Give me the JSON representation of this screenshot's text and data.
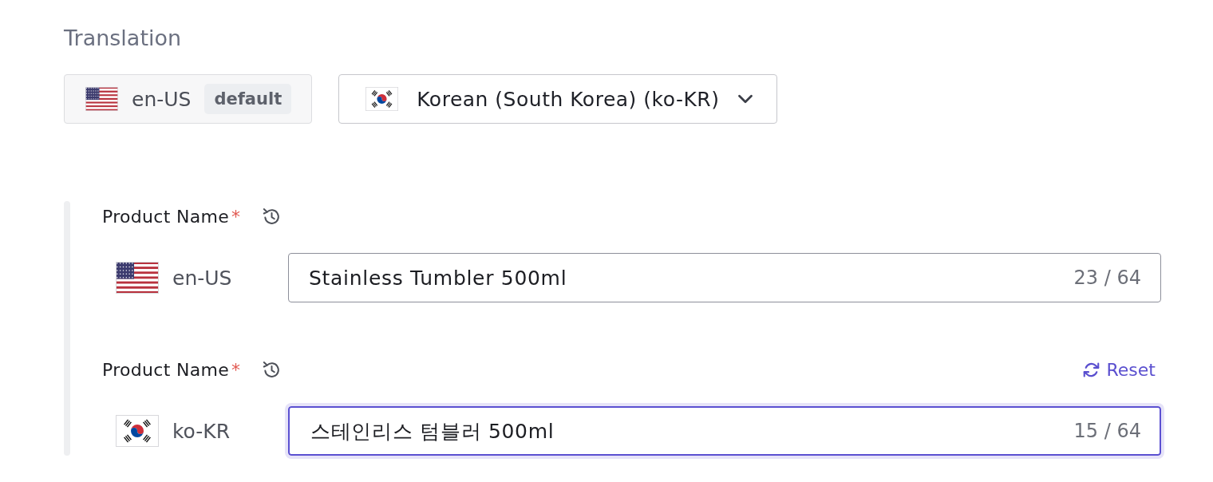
{
  "title": "Translation",
  "locale_bar": {
    "default_locale": {
      "code": "en-US",
      "badge": "default"
    },
    "target_locale": {
      "label": "Korean (South Korea) (ko-KR)"
    }
  },
  "fields": [
    {
      "kind": "source",
      "label": "Product Name",
      "required_mark": "*",
      "locale": "en-US",
      "value": "Stainless Tumbler 500ml",
      "counter": "23 / 64",
      "focused": false
    },
    {
      "kind": "target",
      "label": "Product Name",
      "required_mark": "*",
      "reset_label": "Reset",
      "locale": "ko-KR",
      "value": "스테인리스 텀블러 500ml",
      "counter": "15 / 64",
      "focused": true
    }
  ]
}
